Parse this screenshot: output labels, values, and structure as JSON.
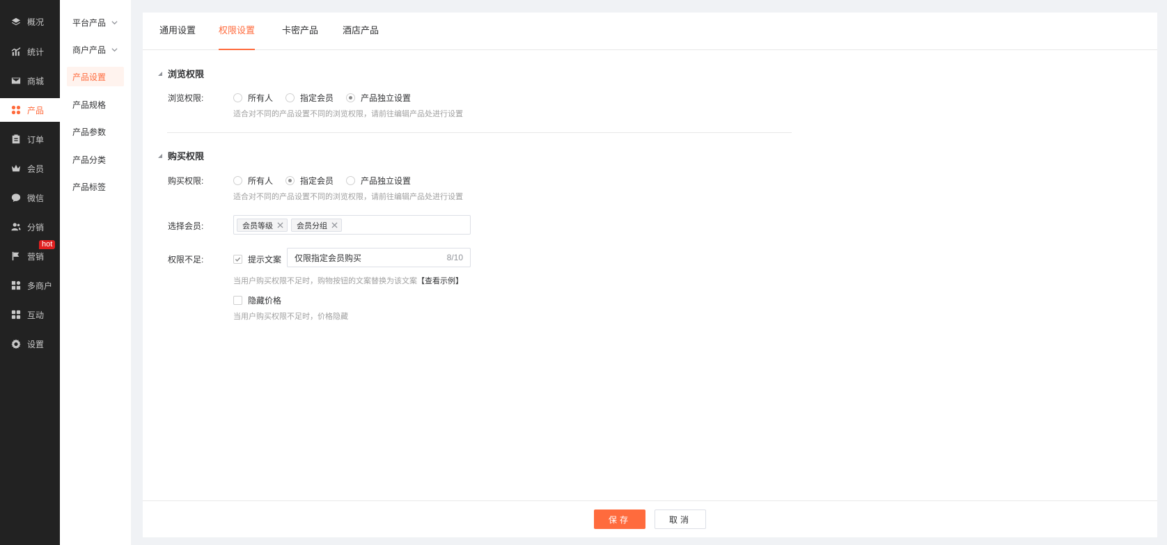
{
  "nav": {
    "items": [
      {
        "label": "概况",
        "icon": "layers-icon"
      },
      {
        "label": "统计",
        "icon": "chart-icon"
      },
      {
        "label": "商城",
        "icon": "mail-icon"
      },
      {
        "label": "产品",
        "icon": "grid-icon",
        "active": true
      },
      {
        "label": "订单",
        "icon": "clipboard-icon"
      },
      {
        "label": "会员",
        "icon": "crown-icon"
      },
      {
        "label": "微信",
        "icon": "wechat-icon"
      },
      {
        "label": "分销",
        "icon": "users-icon"
      },
      {
        "label": "营销",
        "icon": "flag-icon",
        "badge": "hot"
      },
      {
        "label": "多商户",
        "icon": "store-icon"
      },
      {
        "label": "互动",
        "icon": "apps-icon"
      },
      {
        "label": "设置",
        "icon": "gear-icon"
      }
    ]
  },
  "subnav": {
    "items": [
      {
        "label": "平台产品",
        "expandable": true
      },
      {
        "label": "商户产品",
        "expandable": true
      },
      {
        "label": "产品设置",
        "active": true
      },
      {
        "label": "产品规格"
      },
      {
        "label": "产品参数"
      },
      {
        "label": "产品分类"
      },
      {
        "label": "产品标签"
      }
    ]
  },
  "tabs": [
    {
      "label": "通用设置"
    },
    {
      "label": "权限设置",
      "active": true
    },
    {
      "label": "卡密产品"
    },
    {
      "label": "酒店产品"
    }
  ],
  "browse": {
    "title": "浏览权限",
    "label": "浏览权限:",
    "options": [
      "所有人",
      "指定会员",
      "产品独立设置"
    ],
    "selected": "产品独立设置",
    "help": "适合对不同的产品设置不同的浏览权限，请前往编辑产品处进行设置"
  },
  "purchase": {
    "title": "购买权限",
    "label": "购买权限:",
    "options": [
      "所有人",
      "指定会员",
      "产品独立设置"
    ],
    "selected": "指定会员",
    "help": "适合对不同的产品设置不同的浏览权限，请前往编辑产品处进行设置",
    "member_label": "选择会员:",
    "member_tags": [
      "会员等级",
      "会员分组"
    ],
    "insufficient_label": "权限不足:",
    "prompt_check": "提示文案",
    "prompt_checked": true,
    "prompt_value": "仅限指定会员购买",
    "prompt_count": "8/10",
    "prompt_help": "当用户购买权限不足时，购物按钮的文案替换为该文案",
    "prompt_link": "【查看示例】",
    "hide_price_check": "隐藏价格",
    "hide_price_checked": false,
    "hide_price_help": "当用户购买权限不足时，价格隐藏"
  },
  "footer": {
    "save": "保存",
    "cancel": "取消"
  },
  "colors": {
    "accent": "#ff6b3d",
    "nav_bg": "#222222",
    "badge": "#e02020"
  }
}
